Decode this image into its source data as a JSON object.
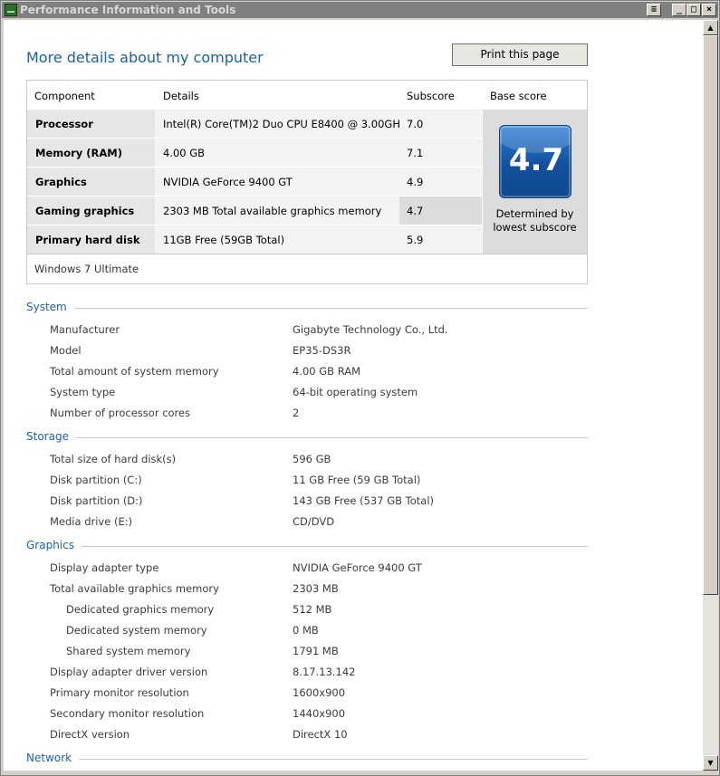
{
  "window": {
    "title": "Performance Information and Tools"
  },
  "page": {
    "title": "More details about my computer",
    "print_button": "Print this page"
  },
  "score_table": {
    "headers": [
      "Component",
      "Details",
      "Subscore",
      "Base score"
    ],
    "rows": [
      {
        "component": "Processor",
        "details": "Intel(R) Core(TM)2 Duo CPU E8400 @ 3.00GHz",
        "subscore": "7.0"
      },
      {
        "component": "Memory (RAM)",
        "details": "4.00 GB",
        "subscore": "7.1"
      },
      {
        "component": "Graphics",
        "details": "NVIDIA GeForce 9400 GT",
        "subscore": "4.9"
      },
      {
        "component": "Gaming graphics",
        "details": "2303 MB Total available graphics memory",
        "subscore": "4.7"
      },
      {
        "component": "Primary hard disk",
        "details": "11GB Free (59GB Total)",
        "subscore": "5.9"
      }
    ],
    "base_score": "4.7",
    "base_caption_line1": "Determined by",
    "base_caption_line2": "lowest subscore",
    "os": "Windows 7 Ultimate"
  },
  "sections": {
    "system": {
      "title": "System",
      "items": [
        {
          "label": "Manufacturer",
          "value": "Gigabyte Technology Co., Ltd."
        },
        {
          "label": "Model",
          "value": "EP35-DS3R"
        },
        {
          "label": "Total amount of system memory",
          "value": "4.00 GB RAM"
        },
        {
          "label": "System type",
          "value": "64-bit operating system"
        },
        {
          "label": "Number of processor cores",
          "value": "2"
        }
      ]
    },
    "storage": {
      "title": "Storage",
      "items": [
        {
          "label": "Total size of hard disk(s)",
          "value": "596 GB"
        },
        {
          "label": "Disk partition (C:)",
          "value": "11 GB Free (59 GB Total)"
        },
        {
          "label": "Disk partition (D:)",
          "value": "143 GB Free (537 GB Total)"
        },
        {
          "label": "Media drive (E:)",
          "value": "CD/DVD"
        }
      ]
    },
    "graphics": {
      "title": "Graphics",
      "items": [
        {
          "label": "Display adapter type",
          "value": "NVIDIA GeForce 9400 GT"
        },
        {
          "label": "Total available graphics memory",
          "value": "2303 MB"
        },
        {
          "label": "Dedicated graphics memory",
          "value": "512 MB"
        },
        {
          "label": "Dedicated system memory",
          "value": "0 MB"
        },
        {
          "label": "Shared system memory",
          "value": "1791 MB"
        },
        {
          "label": "Display adapter driver version",
          "value": "8.17.13.142"
        },
        {
          "label": "Primary monitor resolution",
          "value": "1600x900"
        },
        {
          "label": "Secondary monitor resolution",
          "value": "1440x900"
        },
        {
          "label": "DirectX version",
          "value": "DirectX 10"
        }
      ]
    },
    "network": {
      "title": "Network"
    }
  },
  "icons": {
    "app": "performance-monitor-icon",
    "scroll_up": "arrow-up-icon",
    "scroll_down": "arrow-down-icon"
  },
  "colors": {
    "accent": "#1e5fa8",
    "badge": "#13509c"
  }
}
